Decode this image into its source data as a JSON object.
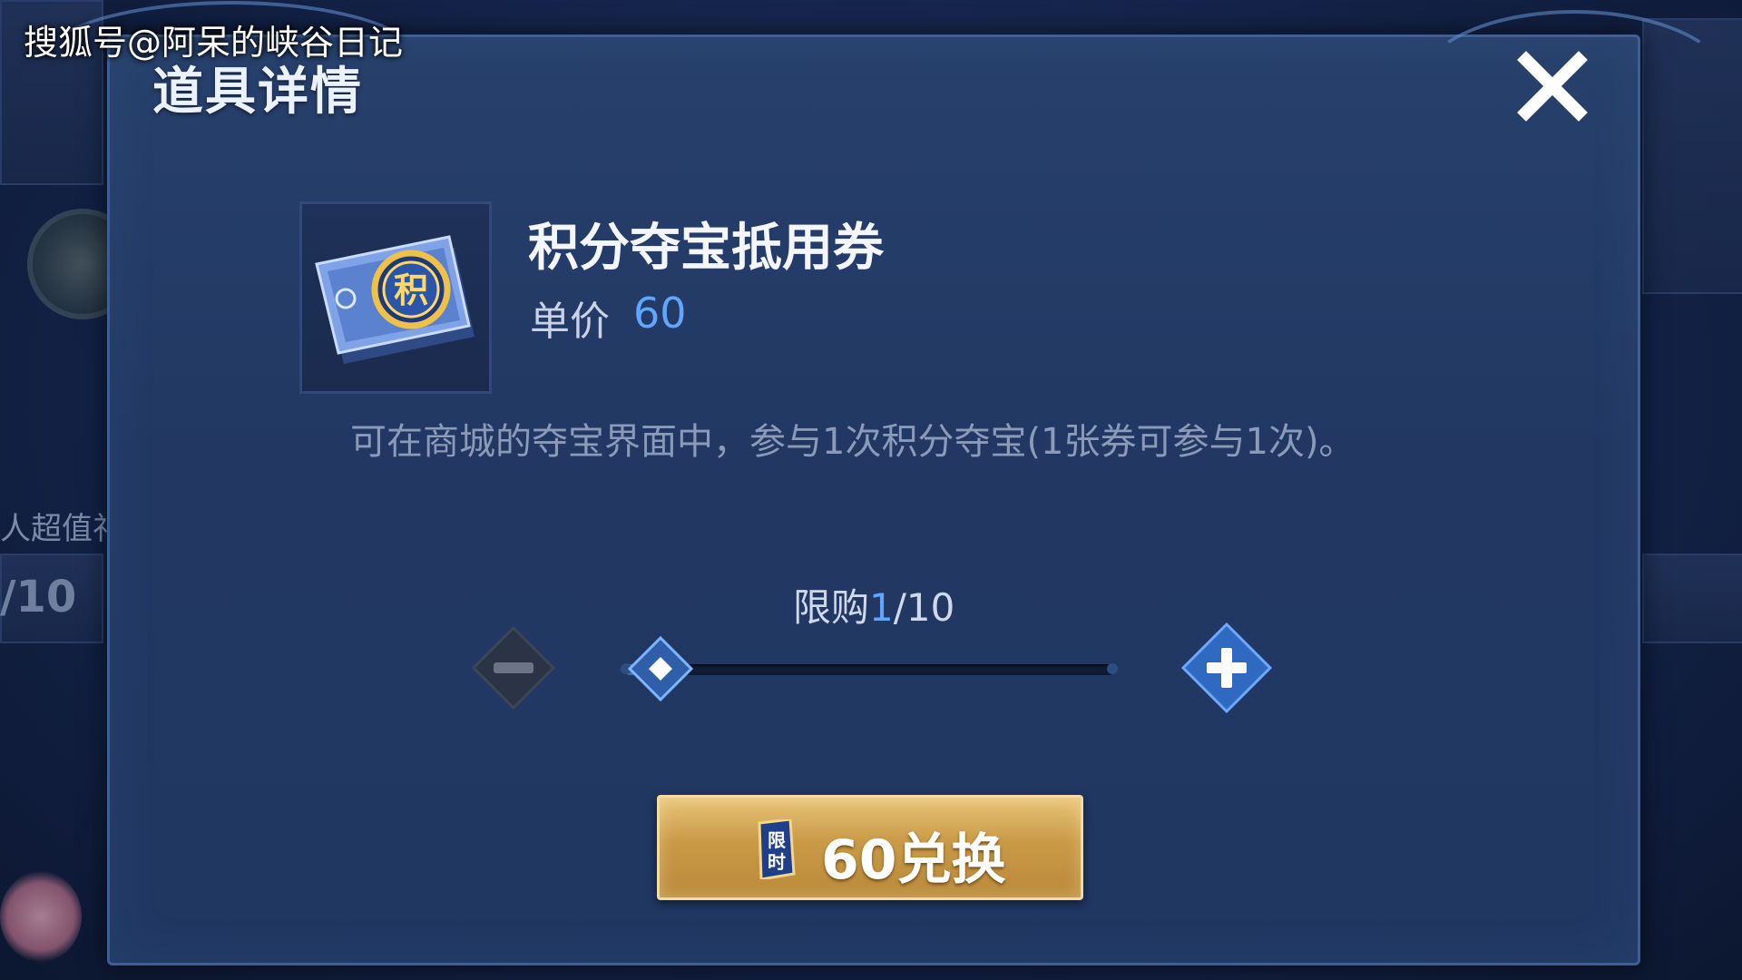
{
  "watermark": "搜狐号@阿呆的峡谷日记",
  "background": {
    "label_text": "人超值礼",
    "count_text": "/10"
  },
  "dialog": {
    "title": "道具详情",
    "close_icon": "close-x-icon"
  },
  "item": {
    "name": "积分夺宝抵用券",
    "price_label": "单价",
    "price_value": "60",
    "icon": "points-ticket-icon",
    "icon_text": "积",
    "description": "可在商城的夺宝界面中，参与1次积分夺宝(1张券可参与1次)。"
  },
  "purchase": {
    "limit_label": "限购",
    "limit_current": "1",
    "limit_sep": "/",
    "limit_max": "10",
    "quantity": 1,
    "quantity_min": 1,
    "quantity_max": 10,
    "minus_enabled": false,
    "plus_enabled": true
  },
  "exchange_button": {
    "badge_icon": "limited-time-badge-icon",
    "badge_text": "限时",
    "label": "60兑换"
  },
  "colors": {
    "accent_blue": "#5fa6ff",
    "gold": "#c99a46",
    "panel": "#223863"
  }
}
